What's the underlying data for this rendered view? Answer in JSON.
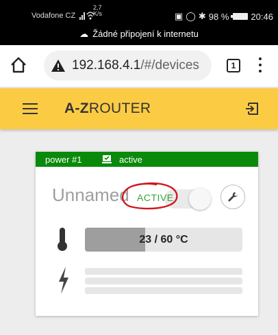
{
  "status_bar": {
    "carrier": "Vodafone CZ",
    "speed_value": "2,7",
    "speed_unit": "K/s",
    "battery": "98 %",
    "time": "20:46",
    "network_message": "Žádné připojení k internetu"
  },
  "browser": {
    "url_host": "192.168.4.1",
    "url_path": "/#/devices",
    "tab_count": "1"
  },
  "app": {
    "title_bold": "A-Z",
    "title_rest": "ROUTER",
    "accent_color": "#fbcb44"
  },
  "device": {
    "header_name": "power #1",
    "header_status": "active",
    "header_color": "#0a8a0a",
    "name": "Unnamed",
    "state": "ACTIVE",
    "toggle_on": false,
    "temperature_text": "23 / 60 °C",
    "temperature_current": 23,
    "temperature_max": 60,
    "power_bars": 3
  },
  "icons": {
    "home": "home-icon",
    "warning": "warning-icon",
    "menu": "hamburger-icon",
    "logout": "logout-icon",
    "status": "monitor-check-icon",
    "settings": "wrench-icon",
    "thermometer": "thermometer-icon",
    "power": "lightning-icon"
  }
}
